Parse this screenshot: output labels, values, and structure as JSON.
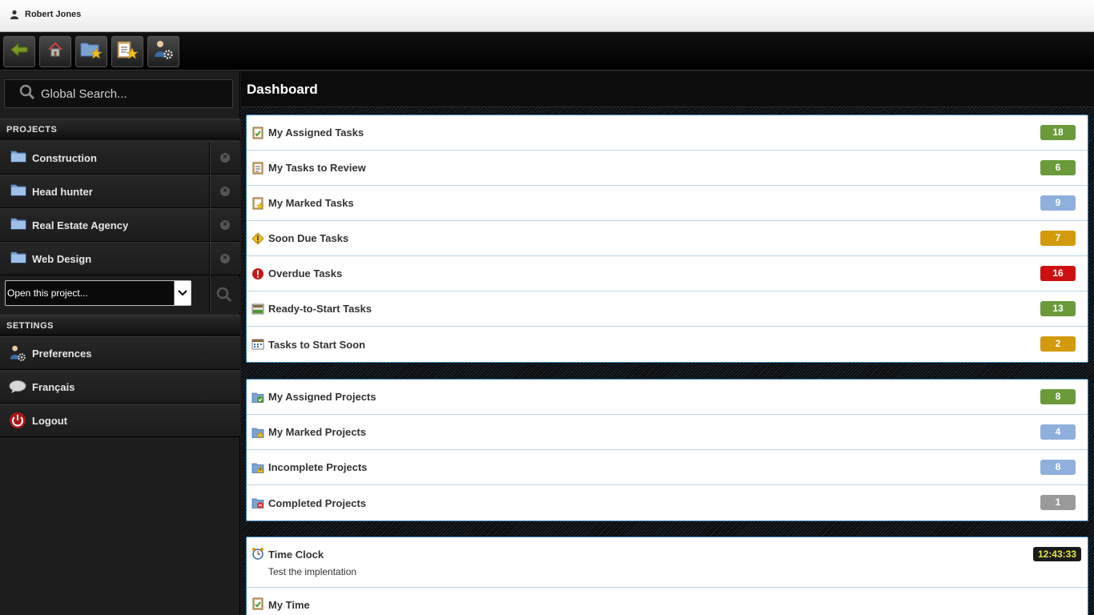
{
  "user": {
    "name": "Robert Jones"
  },
  "toolbar": {
    "buttons": [
      {
        "name": "back-button",
        "icon": "back-arrow-icon"
      },
      {
        "name": "home-button",
        "icon": "home-icon"
      },
      {
        "name": "marked-projects-button",
        "icon": "folder-star-icon"
      },
      {
        "name": "marked-tasks-button",
        "icon": "clipboard-star-icon"
      },
      {
        "name": "preferences-button",
        "icon": "user-gear-icon"
      }
    ]
  },
  "sidebar": {
    "search_placeholder": "Global Search...",
    "projects_heading": "PROJECTS",
    "projects": [
      {
        "label": "Construction"
      },
      {
        "label": "Head hunter"
      },
      {
        "label": "Real Estate Agency"
      },
      {
        "label": "Web Design"
      }
    ],
    "open_project_label": "Open this project...",
    "settings_heading": "SETTINGS",
    "settings": [
      {
        "label": "Preferences",
        "icon": "user-gear-icon"
      },
      {
        "label": "Français",
        "icon": "speech-bubble-icon"
      },
      {
        "label": "Logout",
        "icon": "power-icon"
      }
    ]
  },
  "main": {
    "title": "Dashboard",
    "task_rows": [
      {
        "label": "My Assigned Tasks",
        "count": "18",
        "color": "#6a9a3a",
        "icon": "task-check-icon"
      },
      {
        "label": "My Tasks to Review",
        "count": "6",
        "color": "#6a9a3a",
        "icon": "task-review-icon"
      },
      {
        "label": "My Marked Tasks",
        "count": "9",
        "color": "#8fb0dc",
        "icon": "task-star-icon"
      },
      {
        "label": "Soon Due Tasks",
        "count": "7",
        "color": "#d39a0c",
        "icon": "warning-icon"
      },
      {
        "label": "Overdue Tasks",
        "count": "16",
        "color": "#cc1010",
        "icon": "error-icon"
      },
      {
        "label": "Ready-to-Start Tasks",
        "count": "13",
        "color": "#6a9a3a",
        "icon": "task-ready-icon"
      },
      {
        "label": "Tasks to Start Soon",
        "count": "2",
        "color": "#d39a0c",
        "icon": "task-calendar-icon"
      }
    ],
    "project_rows": [
      {
        "label": "My Assigned Projects",
        "count": "8",
        "color": "#6a9a3a",
        "icon": "project-check-icon"
      },
      {
        "label": "My Marked Projects",
        "count": "4",
        "color": "#8fb0dc",
        "icon": "project-star-icon"
      },
      {
        "label": "Incomplete Projects",
        "count": "8",
        "color": "#8fb0dc",
        "icon": "project-warning-icon"
      },
      {
        "label": "Completed Projects",
        "count": "1",
        "color": "#9a9a9a",
        "icon": "project-done-icon"
      }
    ],
    "time_clock": {
      "label": "Time Clock",
      "task": "Test the implentation",
      "time": "12:43:33"
    },
    "my_time": {
      "label": "My Time"
    }
  }
}
